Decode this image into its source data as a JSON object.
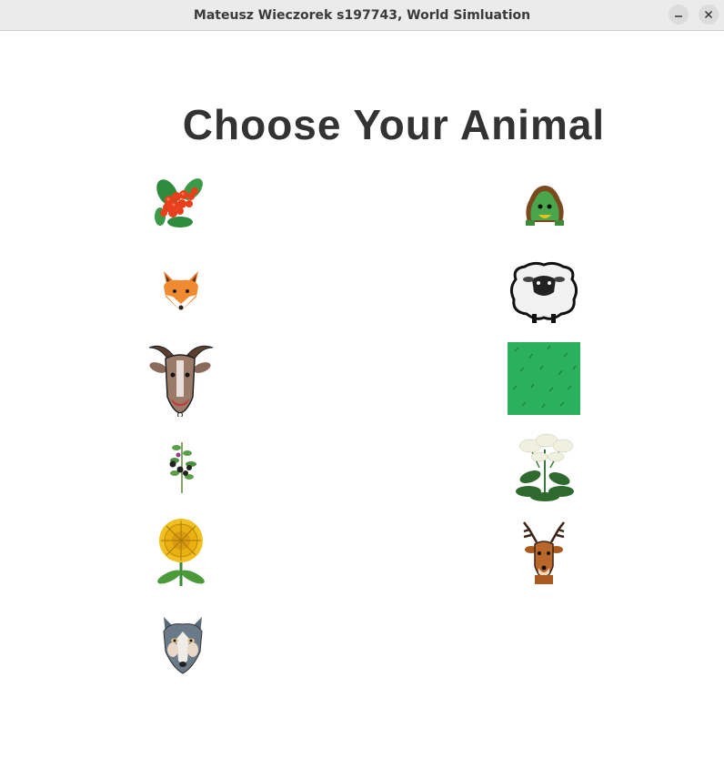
{
  "window": {
    "title": "Mateusz Wieczorek s197743, World Simluation"
  },
  "heading": "Choose Your Animal",
  "choices": [
    {
      "name": "guarana",
      "icon": "red-berries-icon"
    },
    {
      "name": "turtle",
      "icon": "turtle-icon"
    },
    {
      "name": "fox",
      "icon": "fox-icon"
    },
    {
      "name": "sheep",
      "icon": "sheep-icon"
    },
    {
      "name": "antelope",
      "icon": "goat-icon"
    },
    {
      "name": "grass",
      "icon": "grass-icon"
    },
    {
      "name": "belladonna",
      "icon": "belladonna-icon"
    },
    {
      "name": "hogweed",
      "icon": "hogweed-icon"
    },
    {
      "name": "dandelion",
      "icon": "dandelion-icon"
    },
    {
      "name": "deer",
      "icon": "deer-icon"
    },
    {
      "name": "wolf",
      "icon": "wolf-icon"
    }
  ],
  "colors": {
    "titlebar": "#ebebeb",
    "heading": "#333333",
    "grass": "#2bb15c"
  }
}
